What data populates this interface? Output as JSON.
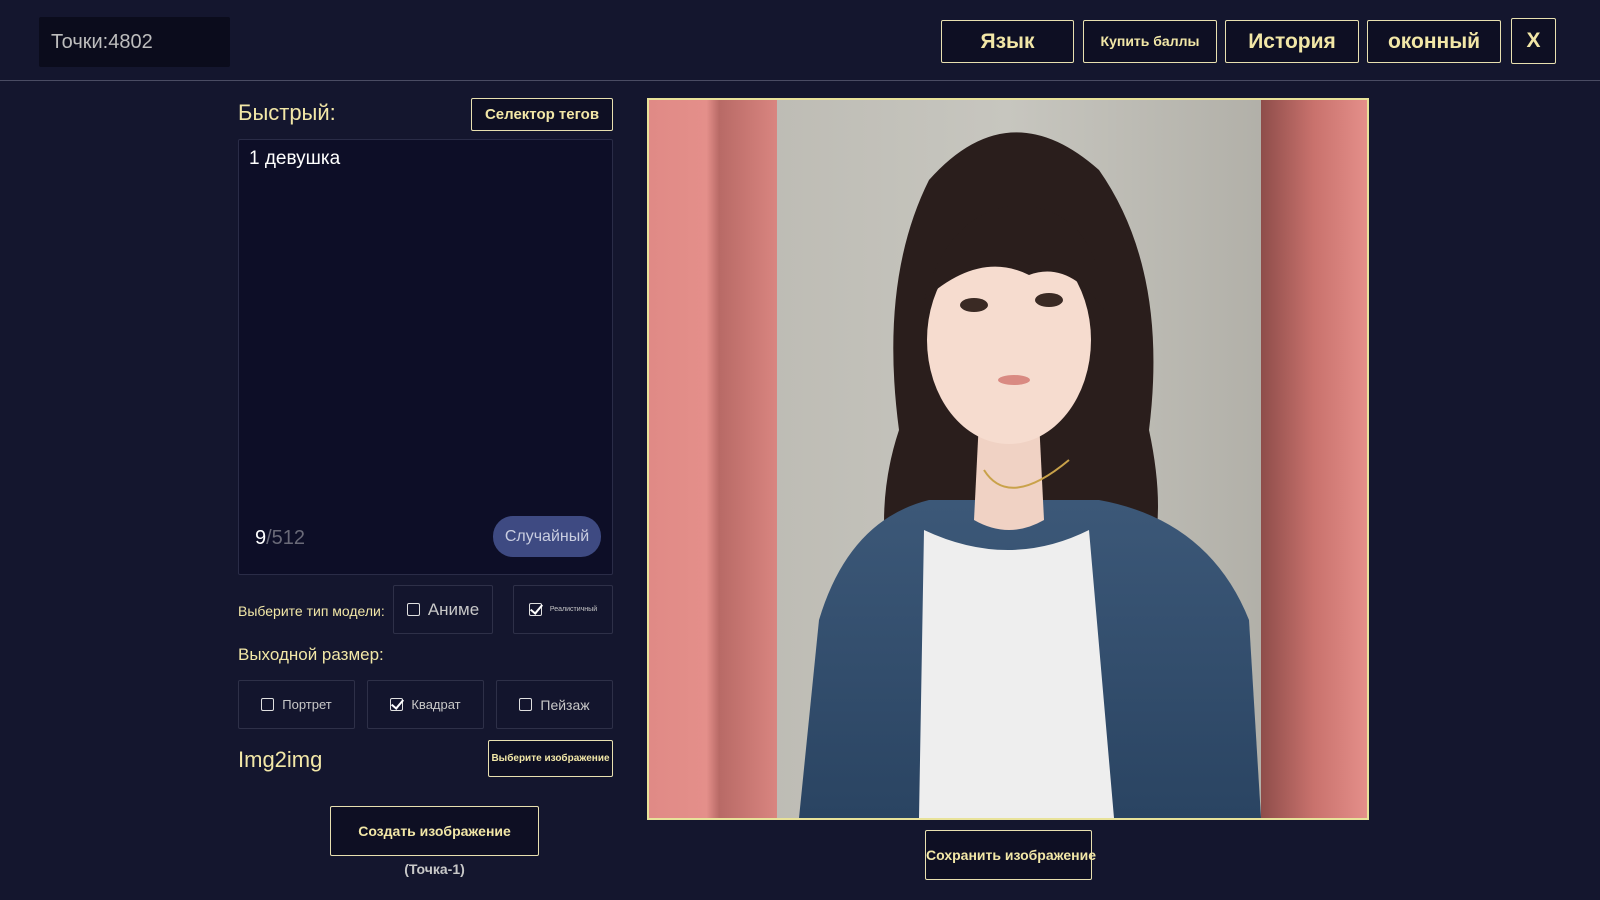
{
  "header": {
    "points_label": "Точки:4802",
    "buttons": {
      "language": "Язык",
      "buy_points": "Купить баллы",
      "history": "История",
      "windowed": "оконный",
      "close": "X"
    }
  },
  "prompt": {
    "title": "Быстрый:",
    "tag_selector": "Селектор тегов",
    "text": "1 девушка",
    "char_count": "9",
    "char_limit": "/512",
    "random_button": "Случайный"
  },
  "model": {
    "label": "Выберите тип модели:",
    "options": [
      {
        "label": "Аниме",
        "checked": false
      },
      {
        "label": "Реалистичный",
        "checked": true
      }
    ]
  },
  "output_size": {
    "label": "Выходной размер:",
    "options": [
      {
        "label": "Портрет",
        "checked": false
      },
      {
        "label": "Квадрат",
        "checked": true
      },
      {
        "label": "Пейзаж",
        "checked": false
      }
    ]
  },
  "img2img": {
    "label": "Img2img",
    "select_button": "Выберите изображение"
  },
  "actions": {
    "create_button": "Создать изображение",
    "cost_note": "(Точка-1)",
    "save_button": "Сохранить изображение"
  },
  "colors": {
    "background": "#14162e",
    "accent_text": "#f2e7a7",
    "button_border": "#e8e0b0",
    "random_button": "#3e4a82",
    "image_border": "#e8e29a"
  }
}
